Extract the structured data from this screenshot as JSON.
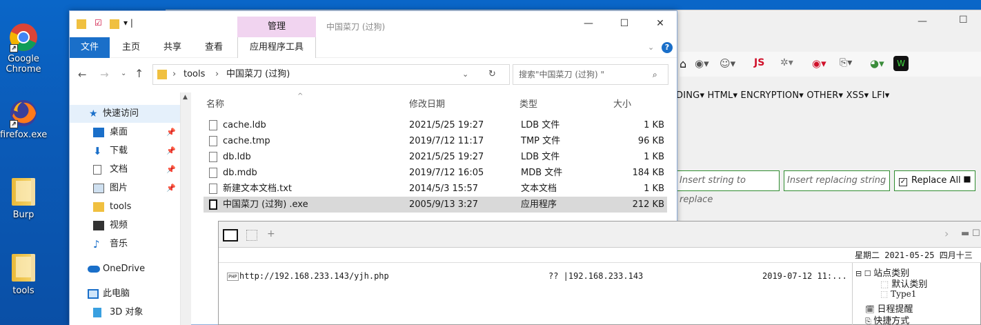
{
  "desktop": {
    "icons": [
      {
        "label": "Google Chrome",
        "icon": "chrome-icon"
      },
      {
        "label": "firefox.exe",
        "icon": "firefox-icon"
      },
      {
        "label": "Burp",
        "icon": "folder-icon"
      },
      {
        "label": "tools",
        "icon": "folder-icon"
      }
    ]
  },
  "browser": {
    "hackbar_menus": "DING▾  HTML▾  ENCRYPTION▾  OTHER▾  XSS▾  LFI▾",
    "insert_placeholder": "Insert string to replace",
    "replacing_placeholder": "Insert replacing string",
    "replace_all": "Replace All",
    "js_label": "JS"
  },
  "explorer": {
    "title": "中国菜刀 (过狗)",
    "manage_tab": "管理",
    "ribbon": {
      "file": "文件",
      "home": "主页",
      "share": "共享",
      "view": "查看",
      "app_tools": "应用程序工具"
    },
    "address": {
      "path1": "tools",
      "path2": "中国菜刀 (过狗)"
    },
    "search_placeholder": "搜索\"中国菜刀 (过狗) \"",
    "nav": [
      {
        "label": "快速访问",
        "icon": "star-icon"
      },
      {
        "label": "桌面",
        "icon": "desktop-icon",
        "pinned": true
      },
      {
        "label": "下载",
        "icon": "download-icon",
        "pinned": true
      },
      {
        "label": "文档",
        "icon": "document-icon",
        "pinned": true
      },
      {
        "label": "图片",
        "icon": "pictures-icon",
        "pinned": true
      },
      {
        "label": "tools",
        "icon": "folder-icon"
      },
      {
        "label": "视频",
        "icon": "video-icon"
      },
      {
        "label": "音乐",
        "icon": "music-icon"
      },
      {
        "label": "OneDrive",
        "icon": "onedrive-icon"
      },
      {
        "label": "此电脑",
        "icon": "pc-icon"
      },
      {
        "label": "3D 对象",
        "icon": "3d-icon"
      }
    ],
    "columns": {
      "name": "名称",
      "date": "修改日期",
      "type": "类型",
      "size": "大小"
    },
    "files": [
      {
        "name": "cache.ldb",
        "date": "2021/5/25 19:27",
        "type": "LDB 文件",
        "size": "1 KB"
      },
      {
        "name": "cache.tmp",
        "date": "2019/7/12 11:17",
        "type": "TMP 文件",
        "size": "96 KB"
      },
      {
        "name": "db.ldb",
        "date": "2021/5/25 19:27",
        "type": "LDB 文件",
        "size": "1 KB"
      },
      {
        "name": "db.mdb",
        "date": "2019/7/12 16:05",
        "type": "MDB 文件",
        "size": "184 KB"
      },
      {
        "name": "新建文本文档.txt",
        "date": "2014/5/3 15:57",
        "type": "文本文档",
        "size": "1 KB"
      },
      {
        "name": "中国菜刀 (过狗) .exe",
        "date": "2005/9/13 3:27",
        "type": "应用程序",
        "size": "212 KB"
      }
    ]
  },
  "caidao": {
    "date_label": "星期二  2021-05-25  四月十三",
    "row": {
      "badge": "PHP",
      "url": "http://192.168.233.143/yjh.php",
      "ip": "?? |192.168.233.143",
      "time": "2019-07-12 11:..."
    },
    "tree": [
      {
        "label": "站点类别",
        "icon": "category-icon"
      },
      {
        "label": "默认类别",
        "icon": "node-icon"
      },
      {
        "label": "Type1",
        "icon": "node-icon"
      },
      {
        "label": "日程提醒",
        "icon": "calendar-icon"
      },
      {
        "label": "快捷方式",
        "icon": "shortcut-icon"
      }
    ]
  }
}
